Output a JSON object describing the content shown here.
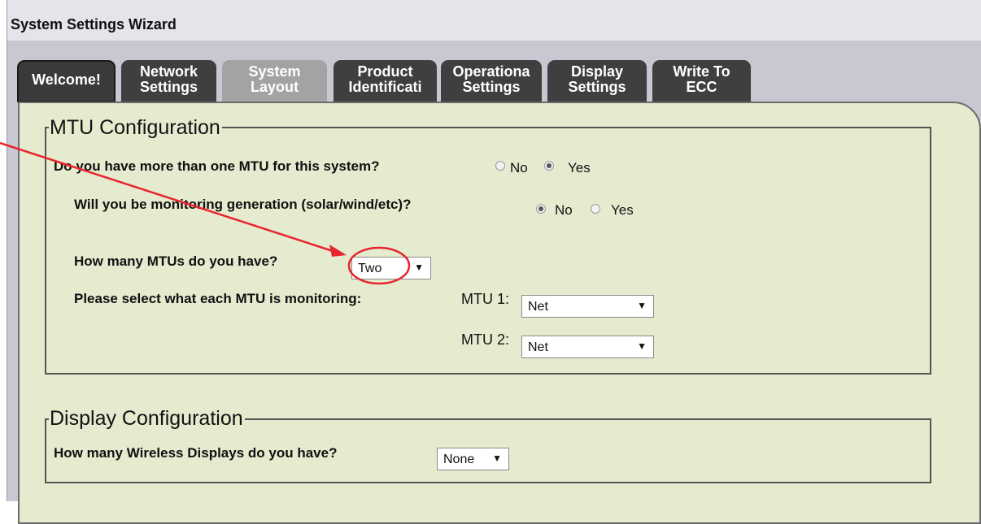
{
  "window": {
    "title": "System Settings Wizard"
  },
  "tabs": [
    {
      "line1": "Welcome!",
      "line2": ""
    },
    {
      "line1": "Network",
      "line2": "Settings"
    },
    {
      "line1": "System",
      "line2": "Layout"
    },
    {
      "line1": "Product",
      "line2": "Identificati"
    },
    {
      "line1": "Operationa",
      "line2": "Settings"
    },
    {
      "line1": "Display",
      "line2": "Settings"
    },
    {
      "line1": "Write To",
      "line2": "ECC"
    }
  ],
  "mtu_config": {
    "legend": "MTU Configuration",
    "multi_mtu": {
      "question": "Do you have more than one MTU for this system?",
      "options": [
        "No",
        "Yes"
      ],
      "selected": "Yes"
    },
    "generation": {
      "question": "Will you be monitoring generation (solar/wind/etc)?",
      "options": [
        "No",
        "Yes"
      ],
      "selected": "No"
    },
    "mtu_count": {
      "question": "How many MTUs do you have?",
      "value": "Two"
    },
    "monitoring": {
      "question": "Please select what each MTU is monitoring:",
      "rows": [
        {
          "label": "MTU 1:",
          "value": "Net"
        },
        {
          "label": "MTU 2:",
          "value": "Net"
        }
      ]
    }
  },
  "display_config": {
    "legend": "Display Configuration",
    "question": "How many Wireless Displays do you have?",
    "value": "None"
  },
  "annotation": {
    "color": "#e8252f"
  }
}
